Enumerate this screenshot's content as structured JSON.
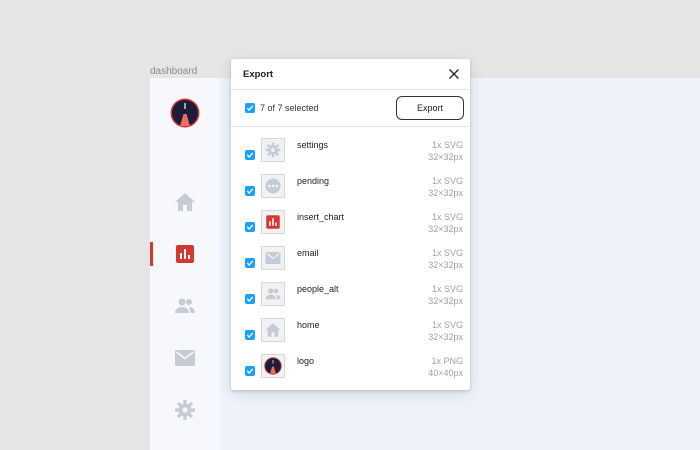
{
  "frame": {
    "label": "dashboard"
  },
  "colors": {
    "accent": "#18a0fb",
    "brand_red": "#d33833",
    "navy": "#1b1d3a",
    "icon_gray": "#c6ccd6"
  },
  "sidebar": {
    "items": [
      {
        "name": "home",
        "icon": "home-icon",
        "active": false
      },
      {
        "name": "insert_chart",
        "icon": "bar-chart-icon",
        "active": true
      },
      {
        "name": "people_alt",
        "icon": "people-icon",
        "active": false
      },
      {
        "name": "email",
        "icon": "mail-icon",
        "active": false
      },
      {
        "name": "settings",
        "icon": "gear-icon",
        "active": false
      }
    ]
  },
  "dialog": {
    "title": "Export",
    "selected_text": "7 of 7 selected",
    "export_label": "Export",
    "assets": [
      {
        "name": "settings",
        "format": "1x SVG",
        "size": "32×32px",
        "icon": "gear-icon",
        "checked": true
      },
      {
        "name": "pending",
        "format": "1x SVG",
        "size": "32×32px",
        "icon": "pending-icon",
        "checked": true
      },
      {
        "name": "insert_chart",
        "format": "1x SVG",
        "size": "32×32px",
        "icon": "bar-chart-icon",
        "checked": true
      },
      {
        "name": "email",
        "format": "1x SVG",
        "size": "32×32px",
        "icon": "mail-icon",
        "checked": true
      },
      {
        "name": "people_alt",
        "format": "1x SVG",
        "size": "32×32px",
        "icon": "people-icon",
        "checked": true
      },
      {
        "name": "home",
        "format": "1x SVG",
        "size": "32×32px",
        "icon": "home-icon",
        "checked": true
      },
      {
        "name": "logo",
        "format": "1x PNG",
        "size": "40×40px",
        "icon": "logo-icon",
        "checked": true
      }
    ]
  }
}
